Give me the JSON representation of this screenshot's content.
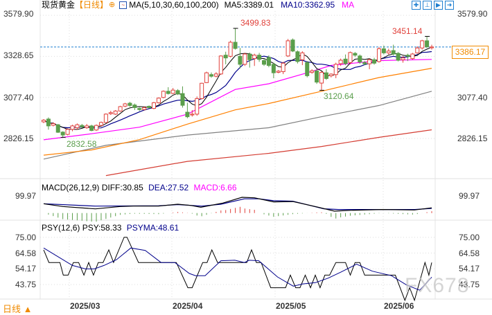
{
  "header": {
    "instrument": "现货黄金",
    "period_tag": "【日线】",
    "ma_params": "MA(5,10,30,60,100,200)",
    "ma5": "MA5:3389.01",
    "ma10": "MA10:3362.95",
    "ma_more": "MA",
    "toolbar_icons": [
      "crosshair-icon",
      "range-icon",
      "play-icon",
      "exit-icon"
    ]
  },
  "colors": {
    "up": "#e0403a",
    "down": "#5a9e4b",
    "ma5": "#000000",
    "ma10": "#00008b",
    "ma30": "#ff00ff",
    "ma60": "#ff8000",
    "ma100": "#808080",
    "ma200": "#d43c32",
    "accent": "#f08a00"
  },
  "price_axis": {
    "ticks": [
      "3579.90",
      "3328.65",
      "3077.40",
      "2826.15"
    ],
    "current_price": "3386.17"
  },
  "annotations": {
    "high1": "3499.83",
    "high2": "3451.14",
    "low1": "2832.58",
    "low2": "3120.64"
  },
  "macd": {
    "title": "MACD(26,12,9)",
    "diff": "DIFF:30.85",
    "dea": "DEA:27.52",
    "macd": "MACD:6.66",
    "tick": "99.97"
  },
  "psy": {
    "title": "PSY(12,6)",
    "psy": "PSY:58.33",
    "psyma": "PSYMA:48.61",
    "ticks": [
      "75.00",
      "64.58",
      "54.17",
      "43.75"
    ]
  },
  "date_axis": [
    "2025/03",
    "2025/04",
    "2025/05",
    "2025/06"
  ],
  "period_selector": "日线 ▲",
  "watermark": "FX678",
  "chart_data": {
    "type": "candlestick",
    "ylim": [
      2760,
      3600
    ],
    "ohlc": [
      [
        2928,
        2945,
        2920,
        2938
      ],
      [
        2945,
        2955,
        2880,
        2903
      ],
      [
        2907,
        2925,
        2900,
        2917
      ],
      [
        2910,
        2915,
        2860,
        2864
      ],
      [
        2865,
        2870,
        2833,
        2847
      ],
      [
        2851,
        2888,
        2845,
        2882
      ],
      [
        2882,
        2910,
        2870,
        2903
      ],
      [
        2892,
        2918,
        2880,
        2910
      ],
      [
        2906,
        2915,
        2890,
        2897
      ],
      [
        2892,
        2915,
        2885,
        2903
      ],
      [
        2903,
        2910,
        2870,
        2875
      ],
      [
        2878,
        2912,
        2872,
        2906
      ],
      [
        2906,
        2930,
        2900,
        2924
      ],
      [
        2924,
        2980,
        2920,
        2975
      ],
      [
        2978,
        2995,
        2970,
        2984
      ],
      [
        2975,
        3000,
        2970,
        2994
      ],
      [
        2994,
        3026,
        2990,
        3021
      ],
      [
        3024,
        3044,
        3018,
        3038
      ],
      [
        3042,
        3050,
        3020,
        3028
      ],
      [
        3031,
        3040,
        3000,
        3015
      ],
      [
        3010,
        3015,
        2995,
        3003
      ],
      [
        3003,
        3022,
        2998,
        3015
      ],
      [
        3023,
        3028,
        3010,
        3015
      ],
      [
        3010,
        3050,
        3005,
        3045
      ],
      [
        3045,
        3078,
        3040,
        3073
      ],
      [
        3077,
        3120,
        3072,
        3115
      ],
      [
        3115,
        3140,
        3095,
        3101
      ],
      [
        3102,
        3135,
        3098,
        3122
      ],
      [
        3119,
        3128,
        3092,
        3098
      ],
      [
        3101,
        3145,
        3015,
        3029
      ],
      [
        2987,
        3045,
        2950,
        2959
      ],
      [
        2970,
        3000,
        2960,
        2975
      ],
      [
        2975,
        3083,
        2965,
        3070
      ],
      [
        3070,
        3167,
        3065,
        3164
      ],
      [
        3168,
        3235,
        3165,
        3228
      ],
      [
        3217,
        3230,
        3198,
        3207
      ],
      [
        3207,
        3232,
        3200,
        3221
      ],
      [
        3221,
        3335,
        3215,
        3331
      ],
      [
        3336,
        3357,
        3280,
        3319
      ],
      [
        3329,
        3425,
        3322,
        3415
      ],
      [
        3415,
        3500,
        3370,
        3377
      ],
      [
        3329,
        3380,
        3255,
        3280
      ],
      [
        3280,
        3350,
        3270,
        3343
      ],
      [
        3343,
        3352,
        3260,
        3308
      ],
      [
        3315,
        3345,
        3270,
        3336
      ],
      [
        3336,
        3350,
        3295,
        3310
      ],
      [
        3303,
        3315,
        3270,
        3280
      ],
      [
        3322,
        3335,
        3262,
        3273
      ],
      [
        3280,
        3290,
        3195,
        3228
      ],
      [
        3231,
        3245,
        3225,
        3238
      ],
      [
        3235,
        3295,
        3220,
        3287
      ],
      [
        3331,
        3435,
        3325,
        3424
      ],
      [
        3429,
        3438,
        3355,
        3361
      ],
      [
        3357,
        3365,
        3285,
        3297
      ],
      [
        3308,
        3360,
        3275,
        3350
      ],
      [
        3291,
        3300,
        3200,
        3210
      ],
      [
        3231,
        3250,
        3222,
        3240
      ],
      [
        3240,
        3250,
        3160,
        3171
      ],
      [
        3165,
        3238,
        3121,
        3231
      ],
      [
        3228,
        3250,
        3185,
        3193
      ],
      [
        3210,
        3225,
        3200,
        3220
      ],
      [
        3217,
        3290,
        3195,
        3280
      ],
      [
        3284,
        3315,
        3270,
        3305
      ],
      [
        3312,
        3340,
        3275,
        3284
      ],
      [
        3291,
        3358,
        3280,
        3352
      ],
      [
        3347,
        3355,
        3325,
        3336
      ],
      [
        3331,
        3340,
        3283,
        3294
      ],
      [
        3291,
        3300,
        3275,
        3283
      ],
      [
        3283,
        3315,
        3250,
        3308
      ],
      [
        3308,
        3320,
        3278,
        3287
      ],
      [
        3297,
        3385,
        3290,
        3375
      ],
      [
        3375,
        3395,
        3340,
        3350
      ],
      [
        3350,
        3375,
        3340,
        3361
      ],
      [
        3364,
        3400,
        3335,
        3343
      ],
      [
        3347,
        3355,
        3298,
        3305
      ],
      [
        3308,
        3330,
        3290,
        3319
      ],
      [
        3336,
        3345,
        3300,
        3329
      ],
      [
        3315,
        3350,
        3308,
        3343
      ],
      [
        3350,
        3390,
        3345,
        3380
      ],
      [
        3380,
        3430,
        3370,
        3424
      ],
      [
        3424,
        3451,
        3380,
        3387
      ],
      [
        3381,
        3400,
        3370,
        3386
      ]
    ],
    "ma30": [
      [
        0,
        2818
      ],
      [
        10,
        2855
      ],
      [
        20,
        2895
      ],
      [
        30,
        2975
      ],
      [
        40,
        3126
      ],
      [
        47,
        3161
      ],
      [
        55,
        3228
      ],
      [
        60,
        3273
      ],
      [
        70,
        3303
      ],
      [
        81,
        3310
      ]
    ],
    "ma60": [
      [
        0,
        2724
      ],
      [
        10,
        2756
      ],
      [
        20,
        2819
      ],
      [
        30,
        2914
      ],
      [
        40,
        3001
      ],
      [
        47,
        3040
      ],
      [
        58,
        3115
      ],
      [
        70,
        3199
      ],
      [
        81,
        3256
      ]
    ],
    "ma100": [
      [
        0,
        2700
      ],
      [
        13,
        2784
      ],
      [
        30,
        2847
      ],
      [
        47,
        2892
      ],
      [
        58,
        2959
      ],
      [
        70,
        3028
      ],
      [
        81,
        3115
      ]
    ],
    "ma200": [
      [
        13,
        2599
      ],
      [
        30,
        2686
      ],
      [
        47,
        2735
      ],
      [
        58,
        2777
      ],
      [
        70,
        2833
      ],
      [
        81,
        2879
      ]
    ],
    "macd_diff": [
      [
        0,
        55
      ],
      [
        4,
        38.5
      ],
      [
        10.8,
        24.6
      ],
      [
        16,
        38.5
      ],
      [
        18.7,
        41
      ],
      [
        24,
        41
      ],
      [
        28,
        52
      ],
      [
        30.7,
        45
      ],
      [
        32.8,
        34
      ],
      [
        37.4,
        59
      ],
      [
        41.4,
        93
      ],
      [
        44,
        90
      ],
      [
        48,
        66
      ],
      [
        52,
        68
      ],
      [
        57.4,
        34
      ],
      [
        60.7,
        11
      ],
      [
        64,
        16
      ],
      [
        70.7,
        21
      ],
      [
        77.4,
        18
      ],
      [
        81,
        30.85
      ]
    ],
    "macd_dea": [
      [
        0,
        55
      ],
      [
        10.8,
        41
      ],
      [
        24,
        43
      ],
      [
        28,
        50
      ],
      [
        33,
        41
      ],
      [
        37,
        52
      ],
      [
        41.9,
        84
      ],
      [
        45,
        84
      ],
      [
        48,
        73
      ],
      [
        52,
        70
      ],
      [
        58.5,
        25
      ],
      [
        61.5,
        21
      ],
      [
        77.5,
        21
      ],
      [
        81,
        27.52
      ]
    ],
    "psy_ylim": [
      28,
      80
    ],
    "psy": [
      [
        0,
        66.67
      ],
      [
        1.1,
        58.33
      ],
      [
        3.4,
        58.33
      ],
      [
        4.1,
        50
      ],
      [
        5.1,
        50
      ],
      [
        6.2,
        58.33
      ],
      [
        7.3,
        58.33
      ],
      [
        8.4,
        50
      ],
      [
        9.4,
        58.33
      ],
      [
        10.4,
        50
      ],
      [
        11.4,
        58.33
      ],
      [
        12.4,
        58.33
      ],
      [
        13.6,
        66.67
      ],
      [
        14.6,
        58.33
      ],
      [
        16.8,
        75
      ],
      [
        17.4,
        75
      ],
      [
        19.8,
        58.33
      ],
      [
        27.7,
        58.33
      ],
      [
        30.1,
        41.67
      ],
      [
        31,
        41.67
      ],
      [
        33.2,
        58.33
      ],
      [
        34.1,
        58.33
      ],
      [
        35.1,
        66.67
      ],
      [
        36.3,
        58.33
      ],
      [
        42.4,
        58.33
      ],
      [
        43.4,
        66.67
      ],
      [
        44.4,
        58.33
      ],
      [
        45.4,
        58.33
      ],
      [
        47.4,
        41.67
      ],
      [
        50.5,
        41.67
      ],
      [
        51.5,
        50
      ],
      [
        52.6,
        41.67
      ],
      [
        53.5,
        41.67
      ],
      [
        54.6,
        50
      ],
      [
        55.7,
        41.67
      ],
      [
        56.7,
        50
      ],
      [
        57.7,
        41.67
      ],
      [
        58.7,
        50
      ],
      [
        59.7,
        50
      ],
      [
        61,
        58.33
      ],
      [
        63,
        58.33
      ],
      [
        64,
        50
      ],
      [
        65,
        58.33
      ],
      [
        66,
        58.33
      ],
      [
        67,
        50
      ],
      [
        73.4,
        50
      ],
      [
        75.4,
        33.33
      ],
      [
        76.4,
        41.67
      ],
      [
        77.4,
        33.33
      ],
      [
        79.6,
        58.33
      ],
      [
        80.4,
        50
      ],
      [
        81,
        58.33
      ]
    ],
    "psyma": [
      [
        0,
        67.9
      ],
      [
        2.4,
        63.3
      ],
      [
        6,
        56.4
      ],
      [
        8.7,
        54.1
      ],
      [
        10.6,
        54.1
      ],
      [
        12.6,
        56.4
      ],
      [
        15.2,
        60.2
      ],
      [
        18.2,
        67.9
      ],
      [
        21.2,
        66.3
      ],
      [
        24.5,
        58.3
      ],
      [
        27.4,
        58.3
      ],
      [
        30.4,
        51.1
      ],
      [
        31.7,
        49.6
      ],
      [
        33.7,
        49.6
      ],
      [
        37,
        59.5
      ],
      [
        39.9,
        59.8
      ],
      [
        41.9,
        58.3
      ],
      [
        42.9,
        59.8
      ],
      [
        44.9,
        59.5
      ],
      [
        48.8,
        48.8
      ],
      [
        52.1,
        42.7
      ],
      [
        54.1,
        44.2
      ],
      [
        56.7,
        45
      ],
      [
        59.4,
        48
      ],
      [
        62,
        51.9
      ],
      [
        65.3,
        57.2
      ],
      [
        68.6,
        52.6
      ],
      [
        72.6,
        49.6
      ],
      [
        75.8,
        43.4
      ],
      [
        78.5,
        40
      ],
      [
        81,
        48.61
      ]
    ]
  }
}
